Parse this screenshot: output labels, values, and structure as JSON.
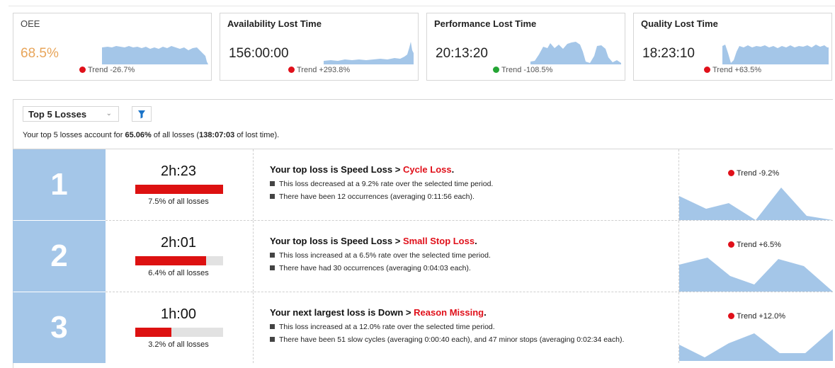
{
  "kpis": {
    "oee": {
      "title": "OEE",
      "value": "68.5%",
      "trend_label": "Trend",
      "trend_value": "-26.7%",
      "trend_status": "down-bad"
    },
    "availability": {
      "title": "Availability Lost Time",
      "value": "156:00:00",
      "trend_label": "Trend",
      "trend_value": "+293.8%",
      "trend_status": "bad"
    },
    "performance": {
      "title": "Performance Lost Time",
      "value": "20:13:20",
      "trend_label": "Trend",
      "trend_value": "-108.5%",
      "trend_status": "good"
    },
    "quality": {
      "title": "Quality Lost Time",
      "value": "18:23:10",
      "trend_label": "Trend",
      "trend_value": "+63.5%",
      "trend_status": "bad"
    }
  },
  "losses": {
    "selector_label": "Top 5 Losses",
    "summary": {
      "prefix": "Your top 5 losses account for ",
      "percent": "65.06%",
      "middle": " of all losses (",
      "time": "138:07:03",
      "suffix": " of lost time)."
    },
    "rows": [
      {
        "rank": "1",
        "duration": "2h:23",
        "share_fraction": 1.0,
        "share_label": "7.5% of all losses",
        "headline_prefix": "Your top loss is Speed Loss > ",
        "headline_highlight": "Cycle Loss",
        "headline_suffix": ".",
        "bullets": [
          "This loss decreased at a 9.2% rate over the selected time period.",
          "There have been 12 occurrences (averaging 0:11:56 each)."
        ],
        "trend_label": "Trend -9.2%"
      },
      {
        "rank": "2",
        "duration": "2h:01",
        "share_fraction": 0.81,
        "share_label": "6.4% of all losses",
        "headline_prefix": "Your top loss is Speed Loss > ",
        "headline_highlight": "Small Stop Loss",
        "headline_suffix": ".",
        "bullets": [
          "This loss increased at a 6.5% rate over the selected time period.",
          "There have had 30 occurrences (averaging 0:04:03 each)."
        ],
        "trend_label": "Trend +6.5%"
      },
      {
        "rank": "3",
        "duration": "1h:00",
        "share_fraction": 0.41,
        "share_label": "3.2% of all losses",
        "headline_prefix": "Your next largest loss is Down > ",
        "headline_highlight": "Reason Missing",
        "headline_suffix": ".",
        "bullets": [
          "This loss increased at a 12.0% rate over the selected time period.",
          "There have been 51 slow cycles (averaging 0:00:40 each), and 47 minor stops (averaging 0:02:34 each)."
        ],
        "trend_label": "Trend +12.0%"
      }
    ]
  },
  "icons": {
    "filter": "filter-icon",
    "chevron": "chevron-down-icon",
    "bullet": "square-bullet-icon",
    "status_dot": "status-dot-icon"
  },
  "colors": {
    "bad": "#e0101a",
    "good": "#24a534",
    "spark_fill": "#a4c6e8",
    "rank_tile": "#a4c6e8",
    "share_bar": "#dd1111",
    "oee_value": "#e8a55a"
  }
}
